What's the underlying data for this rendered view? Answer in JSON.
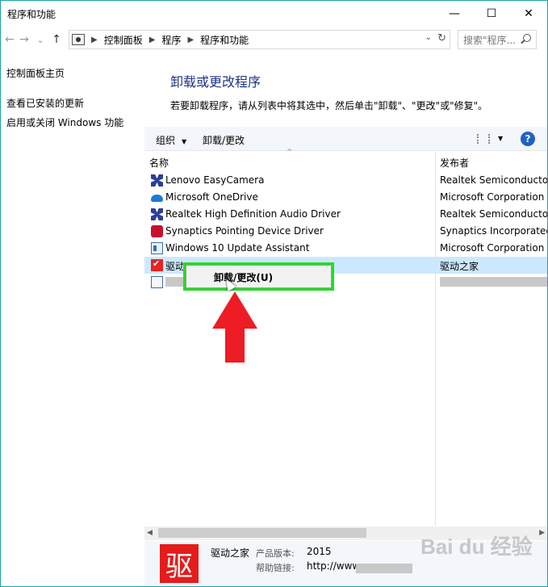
{
  "window": {
    "title": "程序和功能",
    "min": "—",
    "max": "☐",
    "close": "✕"
  },
  "nav": {
    "back": "←",
    "forward": "→",
    "recent": "⌄",
    "up": "↑",
    "crumbs": [
      "控制面板",
      "程序",
      "程序和功能"
    ],
    "search_placeholder": "搜索\"程序...",
    "dropdown": "⌄",
    "refresh": "↻"
  },
  "left": {
    "items": [
      "控制面板主页",
      "查看已安装的更新",
      "启用或关闭 Windows 功能"
    ]
  },
  "main": {
    "title": "卸载或更改程序",
    "desc": "若要卸载程序，请从列表中将其选中，然后单击\"卸载\"、\"更改\"或\"修复\"。"
  },
  "toolbar": {
    "organize": "组织",
    "uninstall": "卸载/更改",
    "caret": "▼",
    "help": "?"
  },
  "columns": {
    "name": "名称",
    "publisher": "发布者",
    "sort": "^"
  },
  "programs": [
    {
      "name": "Lenovo EasyCamera",
      "publisher": "Realtek Semiconductor",
      "icon": "lenovo-icon"
    },
    {
      "name": "Microsoft OneDrive",
      "publisher": "Microsoft Corporation",
      "icon": "onedrive-icon"
    },
    {
      "name": "Realtek High Definition Audio Driver",
      "publisher": "Realtek Semiconductor",
      "icon": "realtek-icon"
    },
    {
      "name": "Synaptics Pointing Device Driver",
      "publisher": "Synaptics Incorporated",
      "icon": "synaptics-icon"
    },
    {
      "name": "Windows 10 Update Assistant",
      "publisher": "Microsoft Corporation",
      "icon": "windows-update-icon"
    },
    {
      "name": "驱动",
      "publisher": "驱动之家",
      "icon": "qudong-icon"
    }
  ],
  "context_menu": {
    "item": "卸载/更改(U)"
  },
  "scrollbar": {
    "left": "◀",
    "right": "▶"
  },
  "details": {
    "icon_char": "驱",
    "name": "驱动之家",
    "version_label": "产品版本:",
    "version": "2015",
    "help_label": "帮助链接:",
    "help_link": "http://www"
  },
  "watermark": "Bai du 经验"
}
